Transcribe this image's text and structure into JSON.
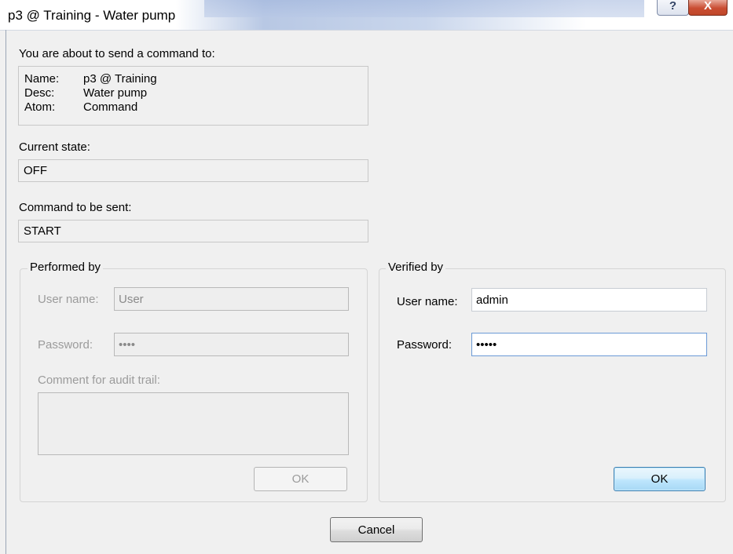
{
  "window": {
    "title": "p3 @ Training - Water pump",
    "help_glyph": "?",
    "close_glyph": "X"
  },
  "intro": {
    "label": "You are about to send a command to:",
    "rows": [
      {
        "key": "Name:",
        "value": "p3 @ Training"
      },
      {
        "key": "Desc:",
        "value": "Water pump"
      },
      {
        "key": "Atom:",
        "value": "Command"
      }
    ]
  },
  "current_state": {
    "label": "Current state:",
    "value": "OFF"
  },
  "command": {
    "label": "Command to be sent:",
    "value": "START"
  },
  "performed_by": {
    "legend": "Performed by",
    "username_label": "User name:",
    "username_value": "User",
    "password_label": "Password:",
    "password_value": "abcd",
    "comment_label": "Comment for audit trail:",
    "comment_value": "",
    "ok_label": "OK"
  },
  "verified_by": {
    "legend": "Verified by",
    "username_label": "User name:",
    "username_value": "admin",
    "password_label": "Password:",
    "password_value": "abcde",
    "ok_label": "OK"
  },
  "footer": {
    "cancel_label": "Cancel"
  }
}
